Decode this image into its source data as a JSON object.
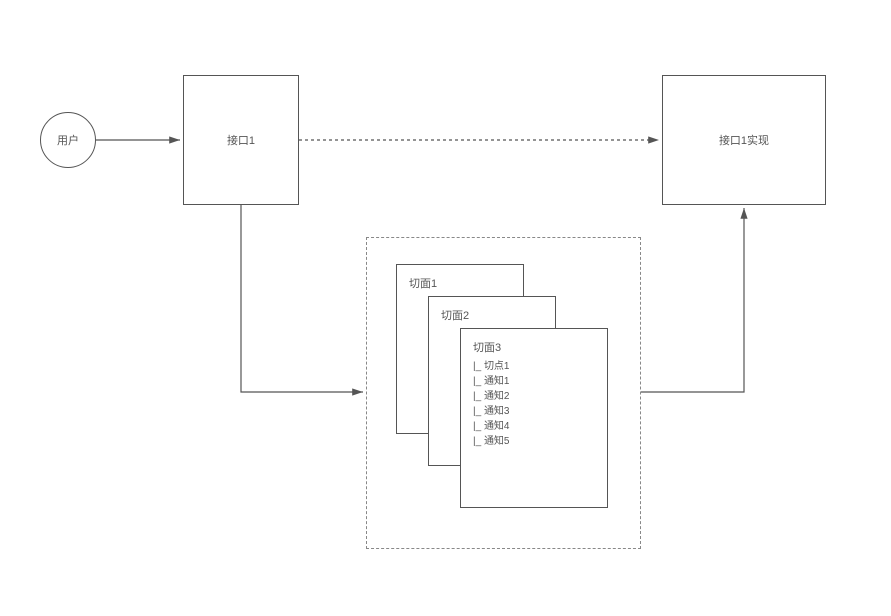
{
  "nodes": {
    "user": "用户",
    "interface1": "接口1",
    "interface1impl": "接口1实现",
    "aspect1": "切面1",
    "aspect2": "切面2",
    "aspect3": {
      "title": "切面3",
      "items": [
        "切点1",
        "通知1",
        "通知2",
        "通知3",
        "通知4",
        "通知5"
      ]
    }
  }
}
